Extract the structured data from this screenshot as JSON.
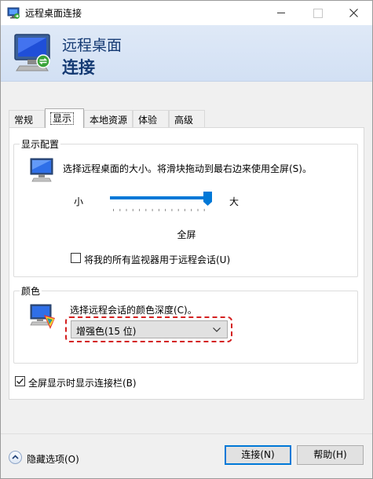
{
  "window": {
    "title": "远程桌面连接"
  },
  "banner": {
    "line1": "远程桌面",
    "line2": "连接"
  },
  "tabs": [
    {
      "label": "常规",
      "active": false
    },
    {
      "label": "显示",
      "active": true
    },
    {
      "label": "本地资源",
      "active": false
    },
    {
      "label": "体验",
      "active": false
    },
    {
      "label": "高级",
      "active": false
    }
  ],
  "display_config": {
    "group_title": "显示配置",
    "description": "选择远程桌面的大小。将滑块拖动到最右边来使用全屏(S)。",
    "slider_min_label": "小",
    "slider_max_label": "大",
    "slider_value_fraction": 1.0,
    "slider_value_label": "全屏",
    "all_monitors_checkbox": {
      "label": "将我的所有监视器用于远程会话(U)",
      "checked": false
    }
  },
  "colors": {
    "group_title": "颜色",
    "description": "选择远程会话的颜色深度(C)。",
    "depth_select": {
      "selected": "增强色(15 位)"
    },
    "highlight_color": "#d42020"
  },
  "connection_bar_checkbox": {
    "label": "全屏显示时显示连接栏(B)",
    "checked": true
  },
  "footer": {
    "hide_options_label": "隐藏选项(O)",
    "connect_label": "连接(N)",
    "help_label": "帮助(H)"
  },
  "icons": {
    "app": "remote-desktop-icon",
    "banner": "remote-desktop-monitor-icon",
    "display": "monitor-icon",
    "color": "color-palette-monitor-icon",
    "hide": "chevron-up-icon"
  },
  "accent_color": "#0078d7",
  "banner_text_color": "#153a73"
}
